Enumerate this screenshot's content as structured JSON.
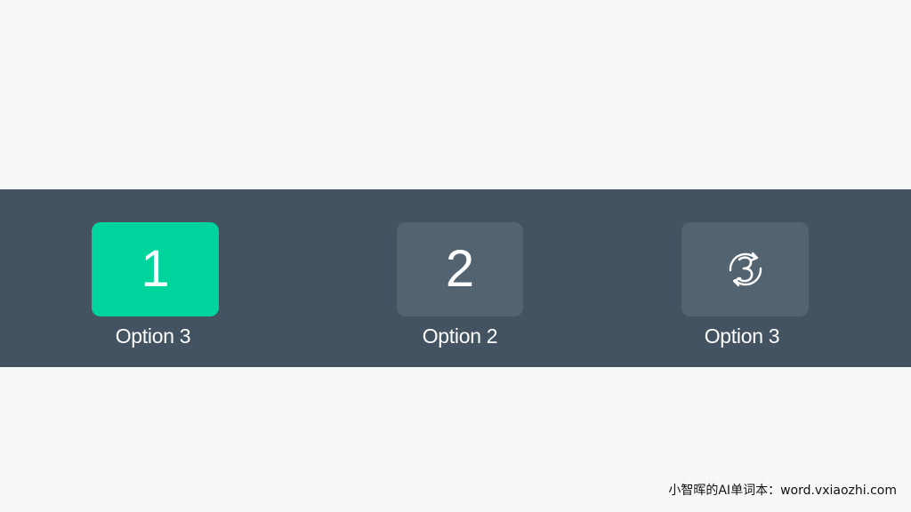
{
  "options": [
    {
      "number": "1",
      "label": "Option 3",
      "active": true
    },
    {
      "number": "2",
      "label": "Option 2",
      "active": false
    },
    {
      "icon": "cycle-3-icon",
      "label": "Option 3",
      "active": false
    }
  ],
  "colors": {
    "bar_background": "#435361",
    "tile_background": "#53636f",
    "active_tile": "#00d49d",
    "page_background": "#f7f8f9",
    "text": "#ffffff"
  },
  "watermark": "小智晖的AI单词本：word.vxiaozhi.com"
}
